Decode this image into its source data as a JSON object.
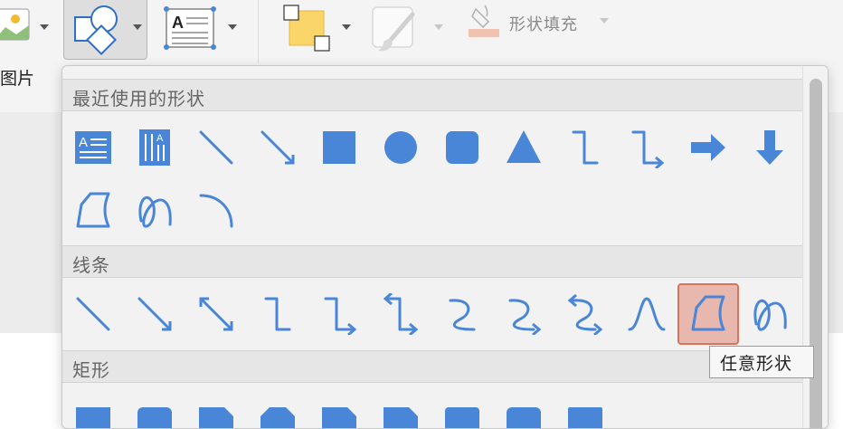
{
  "ribbon": {
    "picture_label": "图片",
    "shape_fill_label": "形状填充"
  },
  "panel": {
    "recent_header": "最近使用的形状",
    "lines_header": "线条",
    "rect_header": "矩形",
    "recent_row1": [
      "text-box-icon",
      "vertical-text-box-icon",
      "line-icon",
      "arrow-line-icon",
      "rectangle-icon",
      "oval-icon",
      "rounded-rectangle-icon",
      "triangle-icon",
      "elbow-connector-icon",
      "elbow-arrow-connector-icon",
      "right-arrow-icon",
      "down-arrow-icon"
    ],
    "recent_row2": [
      "freeform-shape-icon",
      "scribble-icon",
      "arc-icon"
    ],
    "line_row": [
      "line-icon",
      "arrow-line-icon",
      "double-arrow-line-icon",
      "elbow-connector-icon",
      "elbow-arrow-connector-icon",
      "elbow-double-arrow-connector-icon",
      "curved-connector-icon",
      "curved-arrow-connector-icon",
      "curved-double-arrow-connector-icon",
      "curve-icon",
      "freeform-shape-icon",
      "scribble-icon"
    ],
    "selected_shape": "freeform-shape-icon"
  },
  "tooltip": {
    "text": "任意形状"
  },
  "colors": {
    "shape_blue": "#4a86d8",
    "selected_bg": "#e8b7ad",
    "selected_border": "#d9735e",
    "fill_yellow": "#f9d56a"
  }
}
